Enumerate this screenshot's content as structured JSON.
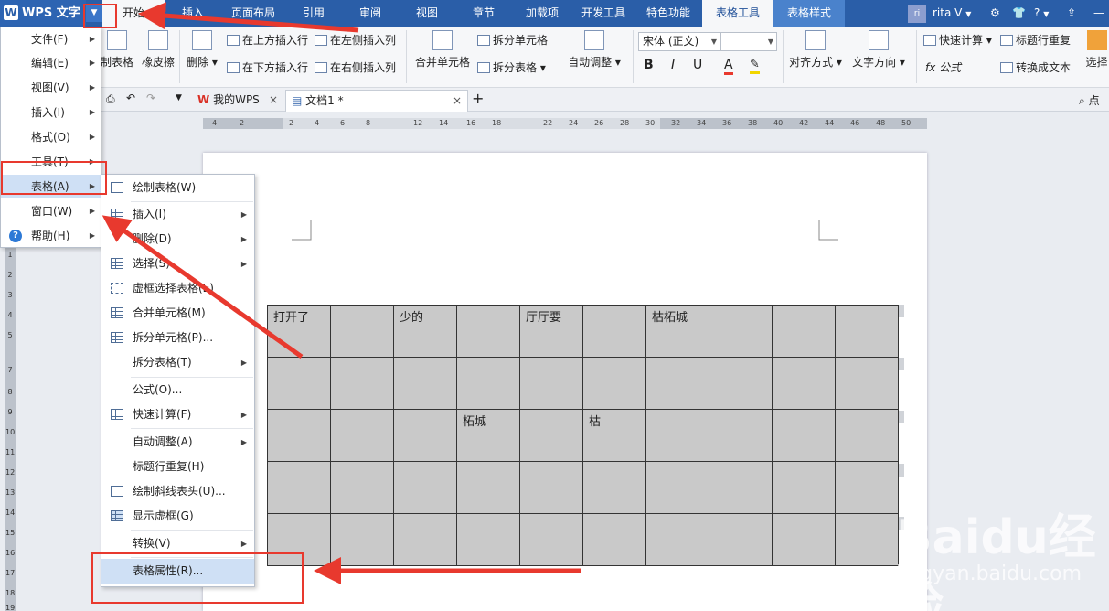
{
  "app": {
    "name": "WPS 文字",
    "logo_letter": "W",
    "menu_arrow": "▼"
  },
  "ribbon_tabs": [
    "开始",
    "插入",
    "页面布局",
    "引用",
    "审阅",
    "视图",
    "章节",
    "加载项",
    "开发工具",
    "特色功能",
    "表格工具",
    "表格样式"
  ],
  "user": {
    "avatar": "ri",
    "name": "rita",
    "badge": "V",
    "help": "?",
    "minimize": "—"
  },
  "ribbon": {
    "draw_table": "制表格",
    "eraser": "橡皮擦",
    "delete": "删除",
    "insert_above": "在上方插入行",
    "insert_below": "在下方插入行",
    "insert_left": "在左侧插入列",
    "insert_right": "在右侧插入列",
    "merge_cells": "合并单元格",
    "split_cells": "拆分单元格",
    "split_table": "拆分表格",
    "auto_fit": "自动调整",
    "font_name": "宋体 (正文)",
    "font_size": "",
    "bold": "B",
    "italic": "I",
    "underline": "U",
    "font_color": "A",
    "align": "对齐方式",
    "text_direction": "文字方向",
    "quick_calc": "快速计算",
    "formula": "fx 公式",
    "title_repeat": "标题行重复",
    "to_text": "转换成文本",
    "select": "选择"
  },
  "doc_tabs": [
    {
      "label": "我的WPS",
      "close": "×"
    },
    {
      "label": "文档1 *",
      "close": "×"
    }
  ],
  "new_tab": "+",
  "search_hint": "点",
  "ruler_h": [
    "4",
    "2",
    "2",
    "4",
    "6",
    "8",
    "12",
    "14",
    "16",
    "18",
    "22",
    "24",
    "26",
    "28",
    "30",
    "32",
    "34",
    "36",
    "38",
    "40",
    "42",
    "44",
    "46",
    "48",
    "50"
  ],
  "ruler_v": [
    "1",
    "2",
    "3",
    "4",
    "5",
    "7",
    "8",
    "9",
    "10",
    "11",
    "12",
    "13",
    "14",
    "15",
    "16",
    "17",
    "18",
    "19"
  ],
  "main_menu": [
    {
      "label": "文件(F)",
      "arrow": "▶"
    },
    {
      "label": "编辑(E)",
      "arrow": "▶"
    },
    {
      "label": "视图(V)",
      "arrow": "▶"
    },
    {
      "label": "插入(I)",
      "arrow": "▶"
    },
    {
      "label": "格式(O)",
      "arrow": "▶"
    },
    {
      "label": "工具(T)",
      "arrow": "▶"
    },
    {
      "label": "表格(A)",
      "arrow": "▶"
    },
    {
      "label": "窗口(W)",
      "arrow": "▶"
    },
    {
      "label": "帮助(H)",
      "arrow": "▶"
    }
  ],
  "table_submenu": [
    {
      "label": "绘制表格(W)",
      "arrow": ""
    },
    {
      "label": "插入(I)",
      "arrow": "▶"
    },
    {
      "label": "删除(D)",
      "arrow": "▶"
    },
    {
      "label": "选择(S)",
      "arrow": "▶"
    },
    {
      "label": "虚框选择表格(E)",
      "arrow": ""
    },
    {
      "label": "合并单元格(M)",
      "arrow": ""
    },
    {
      "label": "拆分单元格(P)...",
      "arrow": ""
    },
    {
      "label": "拆分表格(T)",
      "arrow": "▶"
    },
    {
      "label": "公式(O)...",
      "arrow": ""
    },
    {
      "label": "快速计算(F)",
      "arrow": "▶"
    },
    {
      "label": "自动调整(A)",
      "arrow": "▶"
    },
    {
      "label": "标题行重复(H)",
      "arrow": ""
    },
    {
      "label": "绘制斜线表头(U)...",
      "arrow": ""
    },
    {
      "label": "显示虚框(G)",
      "arrow": ""
    },
    {
      "label": "转换(V)",
      "arrow": "▶"
    },
    {
      "label": "表格属性(R)...",
      "arrow": ""
    }
  ],
  "table": {
    "rows": [
      [
        "打开了",
        "",
        "少的",
        "",
        "厅厅要",
        "",
        "枯柘城",
        "",
        "",
        ""
      ],
      [
        "",
        "",
        "",
        "",
        "",
        "",
        "",
        "",
        "",
        ""
      ],
      [
        "",
        "",
        "",
        "柘城",
        "",
        "枯",
        "",
        "",
        "",
        ""
      ],
      [
        "",
        "",
        "",
        "",
        "",
        "",
        "",
        "",
        "",
        ""
      ],
      [
        "",
        "",
        "",
        "",
        "",
        "",
        "",
        "",
        "",
        ""
      ]
    ]
  },
  "watermark": {
    "text": "Baidu经验",
    "sub": "jingyan.baidu.com"
  },
  "colors": {
    "accent": "#2a5ea8",
    "annotation": "#e8392e",
    "highlight": "#cfe0f5"
  }
}
